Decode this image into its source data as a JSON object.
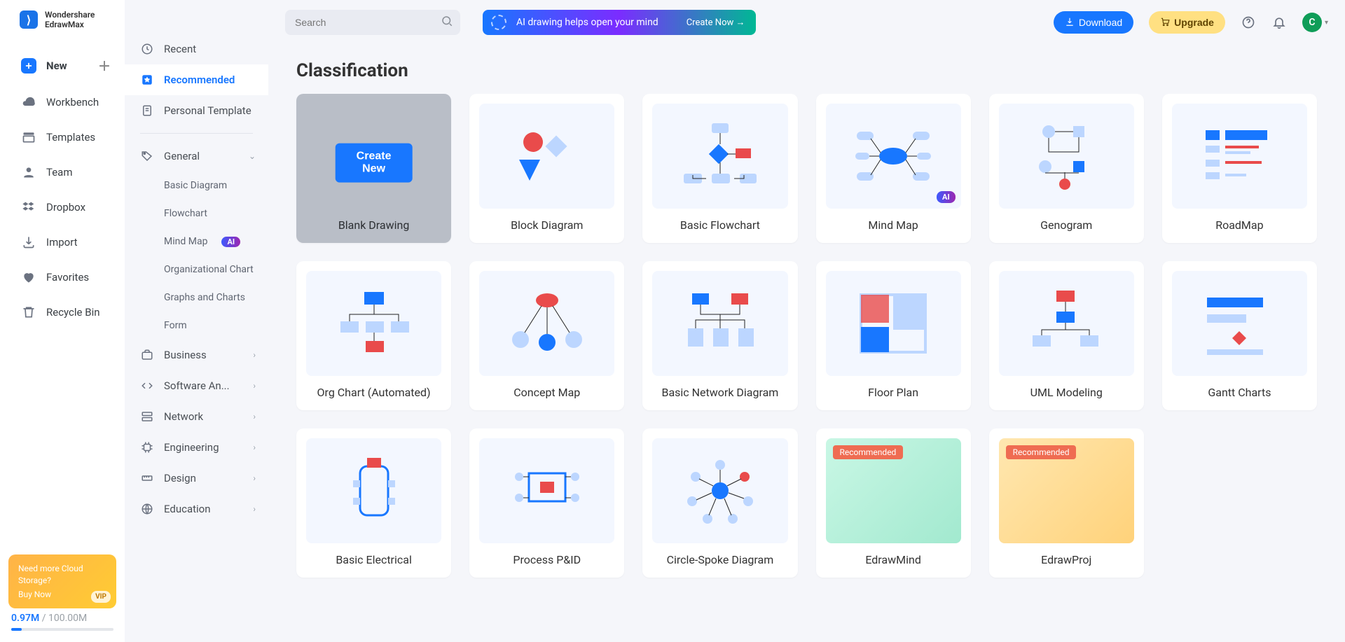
{
  "brand": {
    "name": "Wondershare\nEdrawMax",
    "mark": "⟩"
  },
  "nav": {
    "items": [
      {
        "key": "new",
        "label": "New",
        "plus": true
      },
      {
        "key": "workbench",
        "label": "Workbench"
      },
      {
        "key": "templates",
        "label": "Templates"
      },
      {
        "key": "team",
        "label": "Team"
      },
      {
        "key": "dropbox",
        "label": "Dropbox"
      },
      {
        "key": "import",
        "label": "Import"
      },
      {
        "key": "favorites",
        "label": "Favorites"
      },
      {
        "key": "recycle",
        "label": "Recycle Bin"
      }
    ],
    "promo": {
      "line1": "Need more Cloud Storage?",
      "buy": "Buy Now",
      "vip": "VIP"
    },
    "storage": {
      "used": "0.97M",
      "sep": " / ",
      "total": "100.00M"
    }
  },
  "cats": {
    "top": [
      {
        "key": "recent",
        "label": "Recent"
      },
      {
        "key": "recommended",
        "label": "Recommended",
        "active": true
      },
      {
        "key": "personal",
        "label": "Personal Template"
      }
    ],
    "general_label": "General",
    "general_subs": [
      {
        "key": "basic-diagram",
        "label": "Basic Diagram"
      },
      {
        "key": "flowchart",
        "label": "Flowchart"
      },
      {
        "key": "mind-map",
        "label": "Mind Map",
        "ai": "AI"
      },
      {
        "key": "org-chart",
        "label": "Organizational Chart"
      },
      {
        "key": "graphs",
        "label": "Graphs and Charts"
      },
      {
        "key": "form",
        "label": "Form"
      }
    ],
    "groups": [
      {
        "key": "business",
        "label": "Business"
      },
      {
        "key": "software",
        "label": "Software An..."
      },
      {
        "key": "network",
        "label": "Network"
      },
      {
        "key": "engineering",
        "label": "Engineering"
      },
      {
        "key": "design",
        "label": "Design"
      },
      {
        "key": "education",
        "label": "Education"
      }
    ]
  },
  "top": {
    "search_placeholder": "Search",
    "banner_text": "AI drawing helps open your mind",
    "banner_cta": "Create Now  →",
    "download": "Download",
    "upgrade": "Upgrade",
    "avatar_initial": "C"
  },
  "heading": "Classification",
  "cards": [
    {
      "key": "blank",
      "label": "Blank Drawing",
      "blank": true,
      "create": "Create New"
    },
    {
      "key": "block",
      "label": "Block Diagram"
    },
    {
      "key": "flowchart",
      "label": "Basic Flowchart"
    },
    {
      "key": "mindmap",
      "label": "Mind Map",
      "ai": "AI"
    },
    {
      "key": "genogram",
      "label": "Genogram"
    },
    {
      "key": "roadmap",
      "label": "RoadMap"
    },
    {
      "key": "orgauto",
      "label": "Org Chart (Automated)"
    },
    {
      "key": "concept",
      "label": "Concept Map"
    },
    {
      "key": "netdiag",
      "label": "Basic Network Diagram"
    },
    {
      "key": "floorplan",
      "label": "Floor Plan"
    },
    {
      "key": "uml",
      "label": "UML Modeling"
    },
    {
      "key": "gantt",
      "label": "Gantt Charts"
    },
    {
      "key": "electrical",
      "label": "Basic Electrical"
    },
    {
      "key": "pid",
      "label": "Process P&ID"
    },
    {
      "key": "circlespoke",
      "label": "Circle-Spoke Diagram"
    },
    {
      "key": "edrawmind",
      "label": "EdrawMind",
      "recommended": "Recommended",
      "app": 1
    },
    {
      "key": "edrawproj",
      "label": "EdrawProj",
      "recommended": "Recommended",
      "app": 2
    }
  ]
}
